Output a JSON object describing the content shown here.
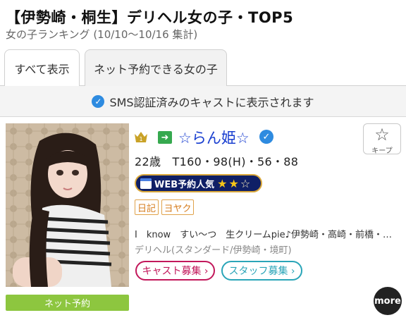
{
  "header": {
    "title": "【伊勢崎・桐生】デリヘル女の子・TOP5",
    "subtitle": "女の子ランキング (10/10〜10/16 集計)"
  },
  "tabs": [
    {
      "label": "すべて表示",
      "active": true
    },
    {
      "label": "ネット予約できる女の子",
      "active": false
    }
  ],
  "notice": {
    "text": "SMS認証済みのキャストに表示されます",
    "icon": "verified-check-icon"
  },
  "cast": {
    "rank": 1,
    "name": "☆らん姫☆",
    "verified": true,
    "profile": "22歳　T160・98(H)・56・88",
    "web_badge": {
      "label": "WEB予約人気",
      "stars_filled": 2,
      "stars_total": 3
    },
    "tags": [
      "日記",
      "ヨヤク"
    ],
    "description": "I　know　すい〜つ　生クリームpie♪伊勢崎・高崎・前橋・…",
    "genre": "デリヘル(スタンダード/伊勢崎・境町)",
    "recruit_cast_label": "キャスト募集 ›",
    "recruit_staff_label": "スタッフ募集 ›",
    "net_reserve_label": "ネット予約",
    "keep_label": "キープ"
  },
  "more_label": "more",
  "colors": {
    "name": "#1a3fd0",
    "accent_green": "#8dc63f",
    "verified": "#2e8be0",
    "cast_recruit": "#c2185b",
    "staff_recruit": "#2aa5b8"
  }
}
